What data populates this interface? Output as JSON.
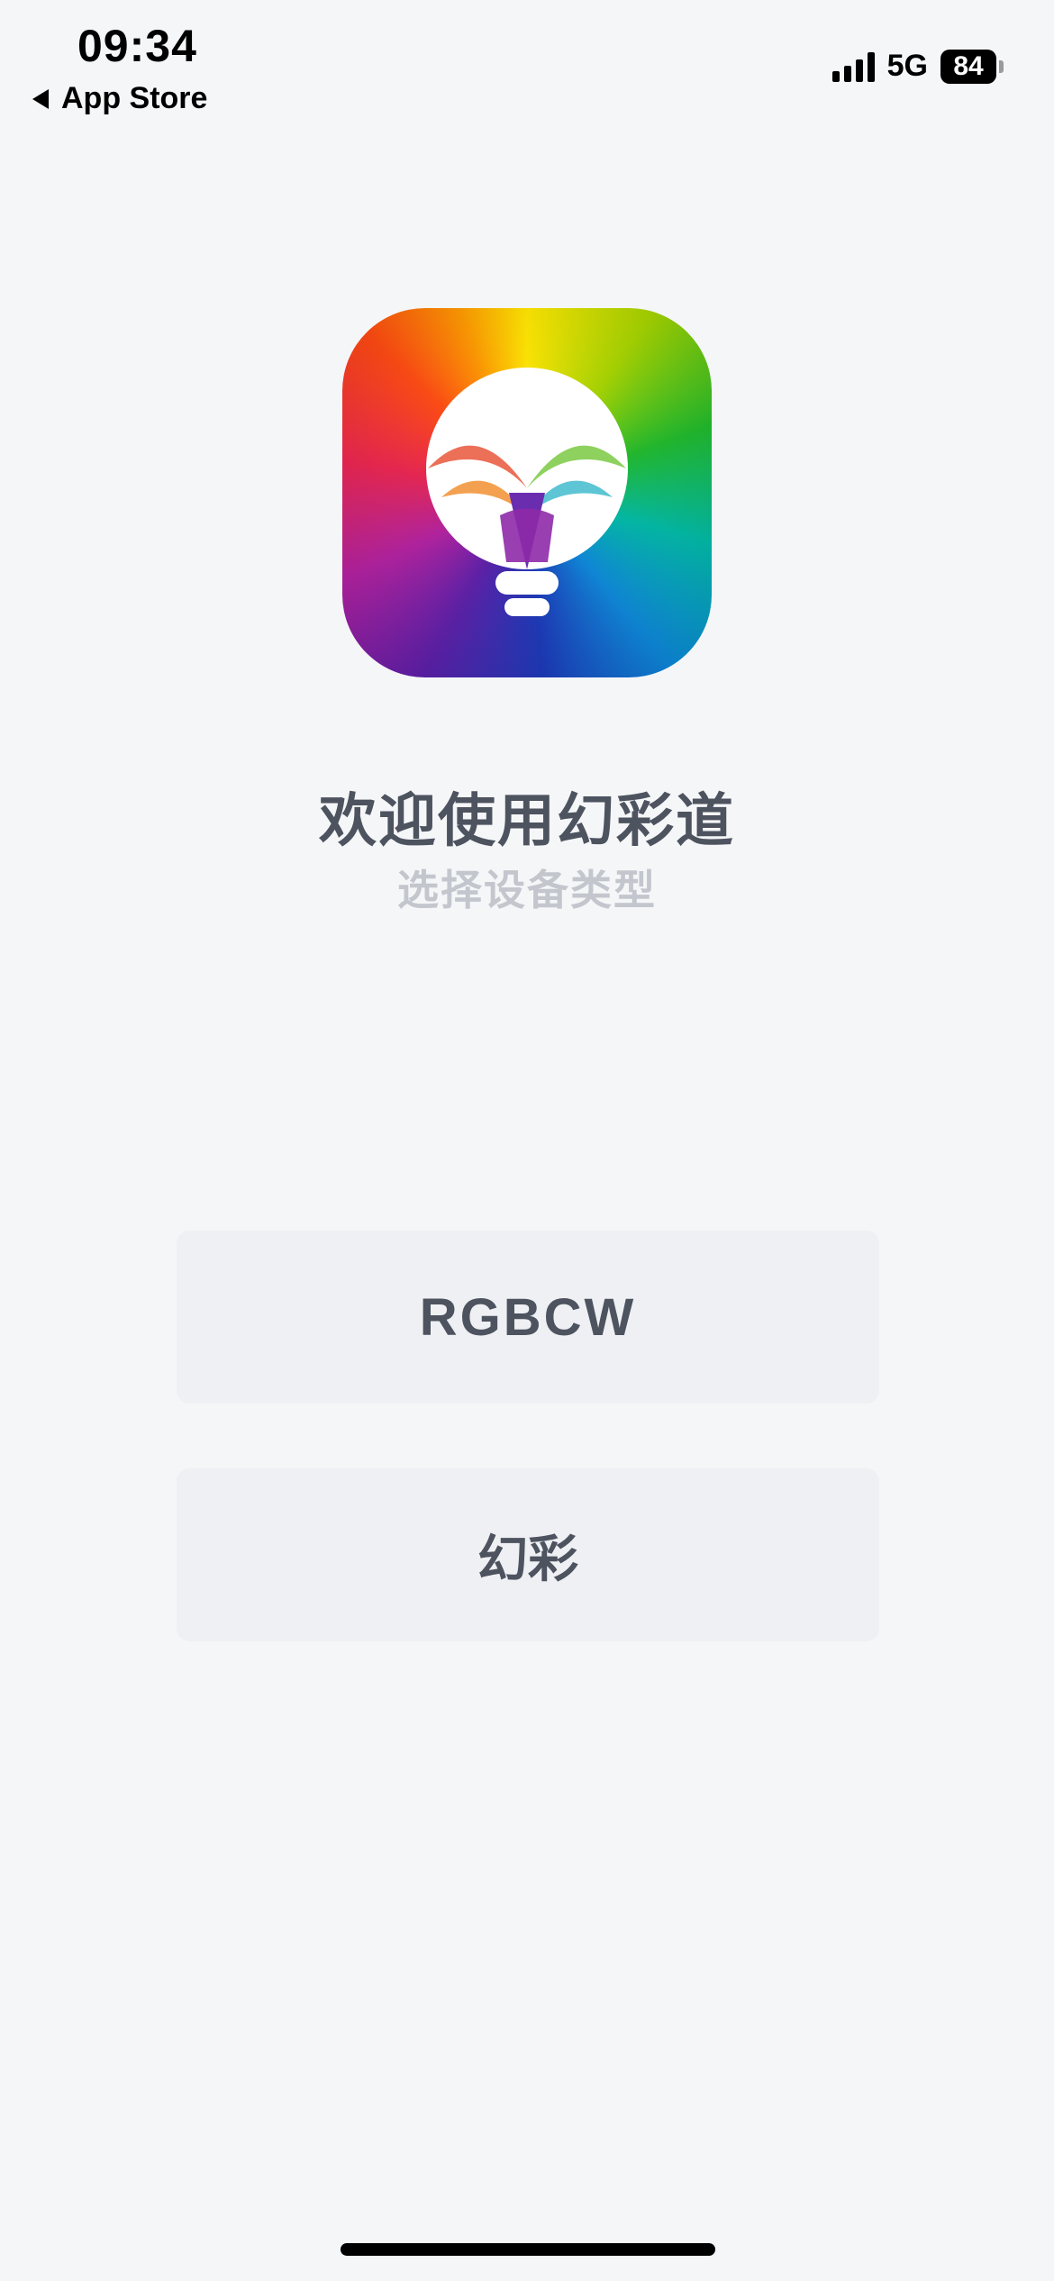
{
  "status_bar": {
    "time": "09:34",
    "back_label": "App Store",
    "network": "5G",
    "battery": "84"
  },
  "icons": {
    "back": "back-caret-icon",
    "signal": "cellular-signal-icon",
    "battery": "battery-icon",
    "logo": "rainbow-bulb-logo"
  },
  "welcome": {
    "title": "欢迎使用幻彩道",
    "subtitle": "选择设备类型"
  },
  "options": [
    {
      "label": "RGBCW"
    },
    {
      "label": "幻彩"
    }
  ],
  "colors": {
    "background": "#f5f6f8",
    "button": "#eff0f3",
    "text": "#4d535f",
    "subtitle": "#c3c6cd"
  }
}
